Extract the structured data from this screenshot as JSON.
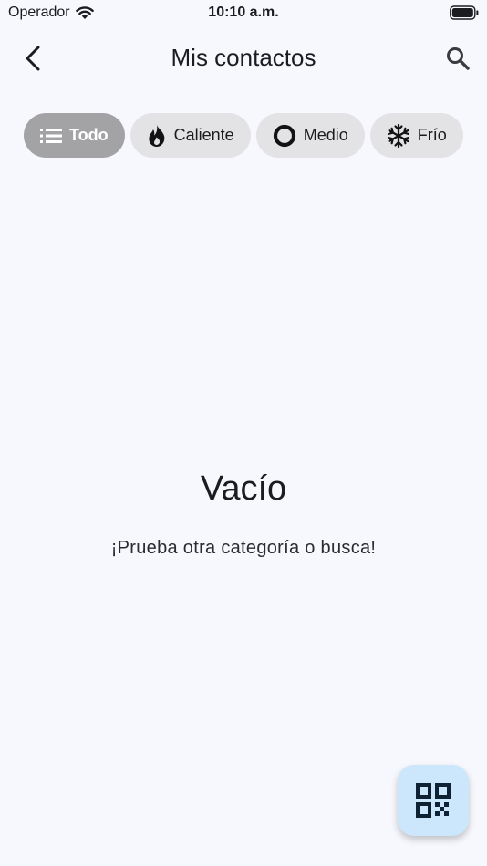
{
  "status_bar": {
    "carrier": "Operador",
    "time": "10:10 a.m."
  },
  "app_bar": {
    "title": "Mis contactos"
  },
  "filters": [
    {
      "label": "Todo",
      "icon": "list-icon",
      "selected": true
    },
    {
      "label": "Caliente",
      "icon": "flame-icon",
      "selected": false
    },
    {
      "label": "Medio",
      "icon": "ring-icon",
      "selected": false
    },
    {
      "label": "Frío",
      "icon": "snowflake-icon",
      "selected": false
    }
  ],
  "empty_state": {
    "title": "Vacío",
    "message": "¡Prueba otra categoría o busca!"
  },
  "fab": {
    "icon": "qr-code-icon"
  },
  "colors": {
    "background": "#f6f8fd",
    "chip": "#e3e3e5",
    "chip_selected": "#a3a3a5",
    "fab": "#cce6fb"
  }
}
